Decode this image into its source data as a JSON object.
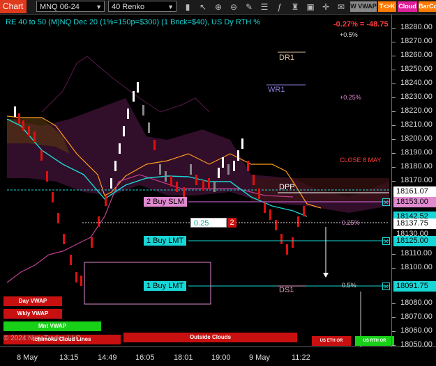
{
  "toolbar": {
    "chart_tab": "Chart",
    "instrument": "MNQ 06-24",
    "bar_type": "40 Renko",
    "badges": {
      "vwap": "W VWAP",
      "tk": "T<>K",
      "cloud": "Cloud",
      "barco": "BarCo"
    }
  },
  "header": {
    "title": "RE 40 to 50 (M)NQ Dec 20 (1%=150p=$300) (1 Brick=$40), US Dy RTH %",
    "change": "-0.27% = -48.75"
  },
  "levels": {
    "p05": "+0.5%",
    "dr1": "DR1",
    "wr1": "WR1",
    "p025": "+0.25%",
    "close": "CLOSE 8 MAY",
    "dpp": "DPP",
    "m025": "0.25%",
    "m05": "0.5%",
    "ds1": "DS1"
  },
  "orders": {
    "stop": "2 Buy SLM",
    "limit1": "1 Buy LMT",
    "limit2": "1 Buy LMT",
    "qty": "0.25",
    "qty_count": "2"
  },
  "buttons": {
    "day_vwap": "Day VWAP",
    "wkly_vwap": "Wkly VWAP",
    "mnt_vwap": "Mnt VWAP",
    "outside_clouds": "Outside Clouds",
    "us_eth": "US ETH OR",
    "us_rth": "US RTH OR"
  },
  "watermark": "© 2024 NinjaTrader, LLC",
  "watermark_overlay": "Ichimoku Cloud Lines",
  "yaxis": {
    "ticks": [
      "18280.00",
      "18270.00",
      "18260.00",
      "18250.00",
      "18240.00",
      "18230.00",
      "18220.00",
      "18210.00",
      "18200.00",
      "18190.00",
      "18180.00",
      "18170.00",
      "18110.00",
      "18100.00",
      "18080.00",
      "18070.00",
      "18060.00",
      "18050.00"
    ],
    "labels": {
      "l1": "18161.07",
      "l2": "18153.00",
      "l3": "18142.52",
      "l4": "18137.75",
      "l5": "18130.00",
      "l6": "18125.00",
      "l7": "18091.75"
    }
  },
  "xaxis": {
    "ticks": [
      "8 May",
      "13:15",
      "14:49",
      "16:05",
      "18:01",
      "19:00",
      "9 May",
      "11:22"
    ]
  },
  "colors": {
    "cyan": "#19d6d6",
    "orange": "#ff9a1f",
    "magenta": "#c0408f",
    "red_brick": "#e01010",
    "white_brick": "#ffffff"
  }
}
